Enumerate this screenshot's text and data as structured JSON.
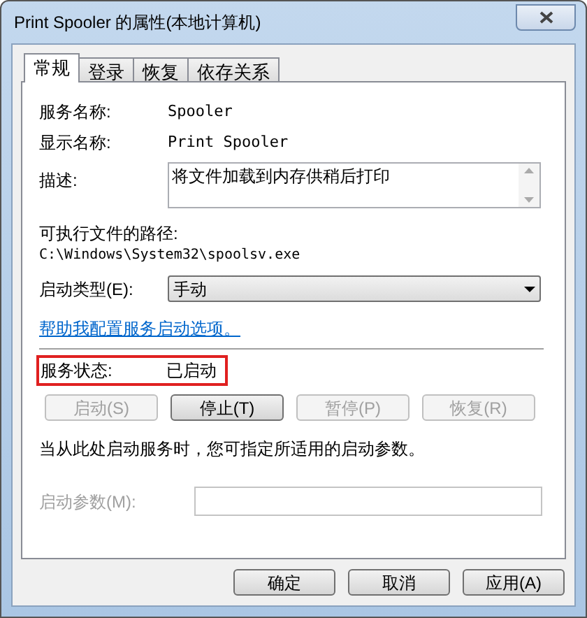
{
  "window": {
    "title": "Print Spooler 的属性(本地计算机)"
  },
  "tabs": [
    {
      "label": "常规",
      "selected": true
    },
    {
      "label": "登录",
      "selected": false
    },
    {
      "label": "恢复",
      "selected": false
    },
    {
      "label": "依存关系",
      "selected": false
    }
  ],
  "service_name": {
    "label": "服务名称:",
    "value": "Spooler"
  },
  "display_name": {
    "label": "显示名称:",
    "value": "Print Spooler"
  },
  "description": {
    "label": "描述:",
    "value": "将文件加载到内存供稍后打印"
  },
  "executable_path": {
    "label": "可执行文件的路径:",
    "value": "C:\\Windows\\System32\\spoolsv.exe"
  },
  "startup_type": {
    "label": "启动类型(E):",
    "value": "手动"
  },
  "help_link": "帮助我配置服务启动选项。",
  "service_status": {
    "label": "服务状态:",
    "value": "已启动",
    "highlighted": true
  },
  "service_buttons": [
    {
      "label": "启动(S)",
      "disabled": true
    },
    {
      "label": "停止(T)",
      "disabled": false
    },
    {
      "label": "暂停(P)",
      "disabled": true
    },
    {
      "label": "恢复(R)",
      "disabled": true
    }
  ],
  "hint": "当从此处启动服务时，您可指定所适用的启动参数。",
  "start_parameters": {
    "label": "启动参数(M):",
    "disabled": true
  },
  "dialog_buttons": [
    {
      "label": "确定",
      "disabled": false
    },
    {
      "label": "取消",
      "disabled": false
    },
    {
      "label": "应用(A)",
      "disabled": false
    }
  ]
}
